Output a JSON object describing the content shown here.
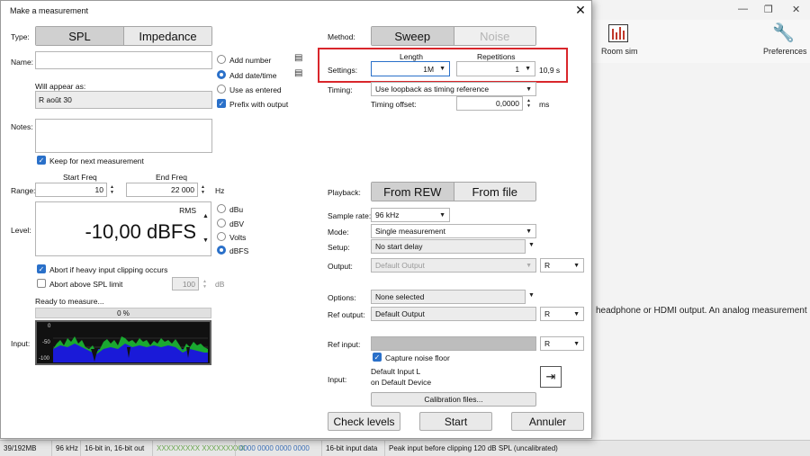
{
  "background": {
    "toolbar": {
      "room_sim": "Room sim",
      "preferences": "Preferences"
    },
    "body_text": "headphone or HDMI output. An analog measurement",
    "statusbar": [
      "39/192MB",
      "96 kHz",
      "16-bit in, 16-bit out",
      "XXXXXXXXX XXXXXXXXX",
      "0000 0000 0000 0000",
      "16-bit input data",
      "Peak input before clipping 120 dB SPL (uncalibrated)"
    ]
  },
  "dialog": {
    "title": "Make a measurement",
    "close": "✕",
    "type_label": "Type:",
    "type_options": [
      "SPL",
      "Impedance"
    ],
    "name_label": "Name:",
    "name_value": "",
    "will_appear_label": "Will appear as:",
    "will_appear_value": "R août 30",
    "name_opts": {
      "add_number": "Add number",
      "add_date": "Add date/time",
      "use_as_entered": "Use as entered",
      "prefix": "Prefix with output"
    },
    "notes_label": "Notes:",
    "keep_label": "Keep for next measurement",
    "start_freq_label": "Start Freq",
    "end_freq_label": "End Freq",
    "range_label": "Range:",
    "start_freq": "10",
    "end_freq": "22 000",
    "hz": "Hz",
    "level_label": "Level:",
    "rms": "RMS",
    "level_value": "-10,00 dBFS",
    "level_units": [
      "dBu",
      "dBV",
      "Volts",
      "dBFS"
    ],
    "abort_clip": "Abort if heavy input clipping occurs",
    "abort_spl": "Abort above SPL limit",
    "spl_limit": "100",
    "db": "dB",
    "ready": "Ready to measure...",
    "progress": "0 %",
    "input_label": "Input:",
    "meter_ticks": [
      "0",
      "-50",
      "-100"
    ],
    "method_label": "Method:",
    "method_options": [
      "Sweep",
      "Noise"
    ],
    "length_label": "Length",
    "repetitions_label": "Repetitions",
    "settings_label": "Settings:",
    "length_value": "1M",
    "repetitions_value": "1",
    "duration": "10,9 s",
    "timing_label": "Timing:",
    "timing_value": "Use loopback as timing reference",
    "timing_offset_label": "Timing offset:",
    "timing_offset": "0,0000",
    "ms": "ms",
    "playback_label": "Playback:",
    "playback_options": [
      "From REW",
      "From file"
    ],
    "sample_rate_label": "Sample rate:",
    "sample_rate": "96 kHz",
    "mode_label": "Mode:",
    "mode": "Single measurement",
    "setup_label": "Setup:",
    "setup": "No start delay",
    "output_label": "Output:",
    "output": "Default Output",
    "output_channel": "R",
    "options_label": "Options:",
    "options": "None selected",
    "ref_output_label": "Ref output:",
    "ref_output": "Default Output",
    "ref_output_channel": "R",
    "ref_input_label": "Ref input:",
    "ref_input_channel": "R",
    "capture_noise": "Capture noise floor",
    "input2_label": "Input:",
    "input_device_1": "Default Input L",
    "input_device_2": "on Default Device",
    "calibration": "Calibration files...",
    "check_levels": "Check levels",
    "start": "Start",
    "cancel": "Annuler"
  }
}
